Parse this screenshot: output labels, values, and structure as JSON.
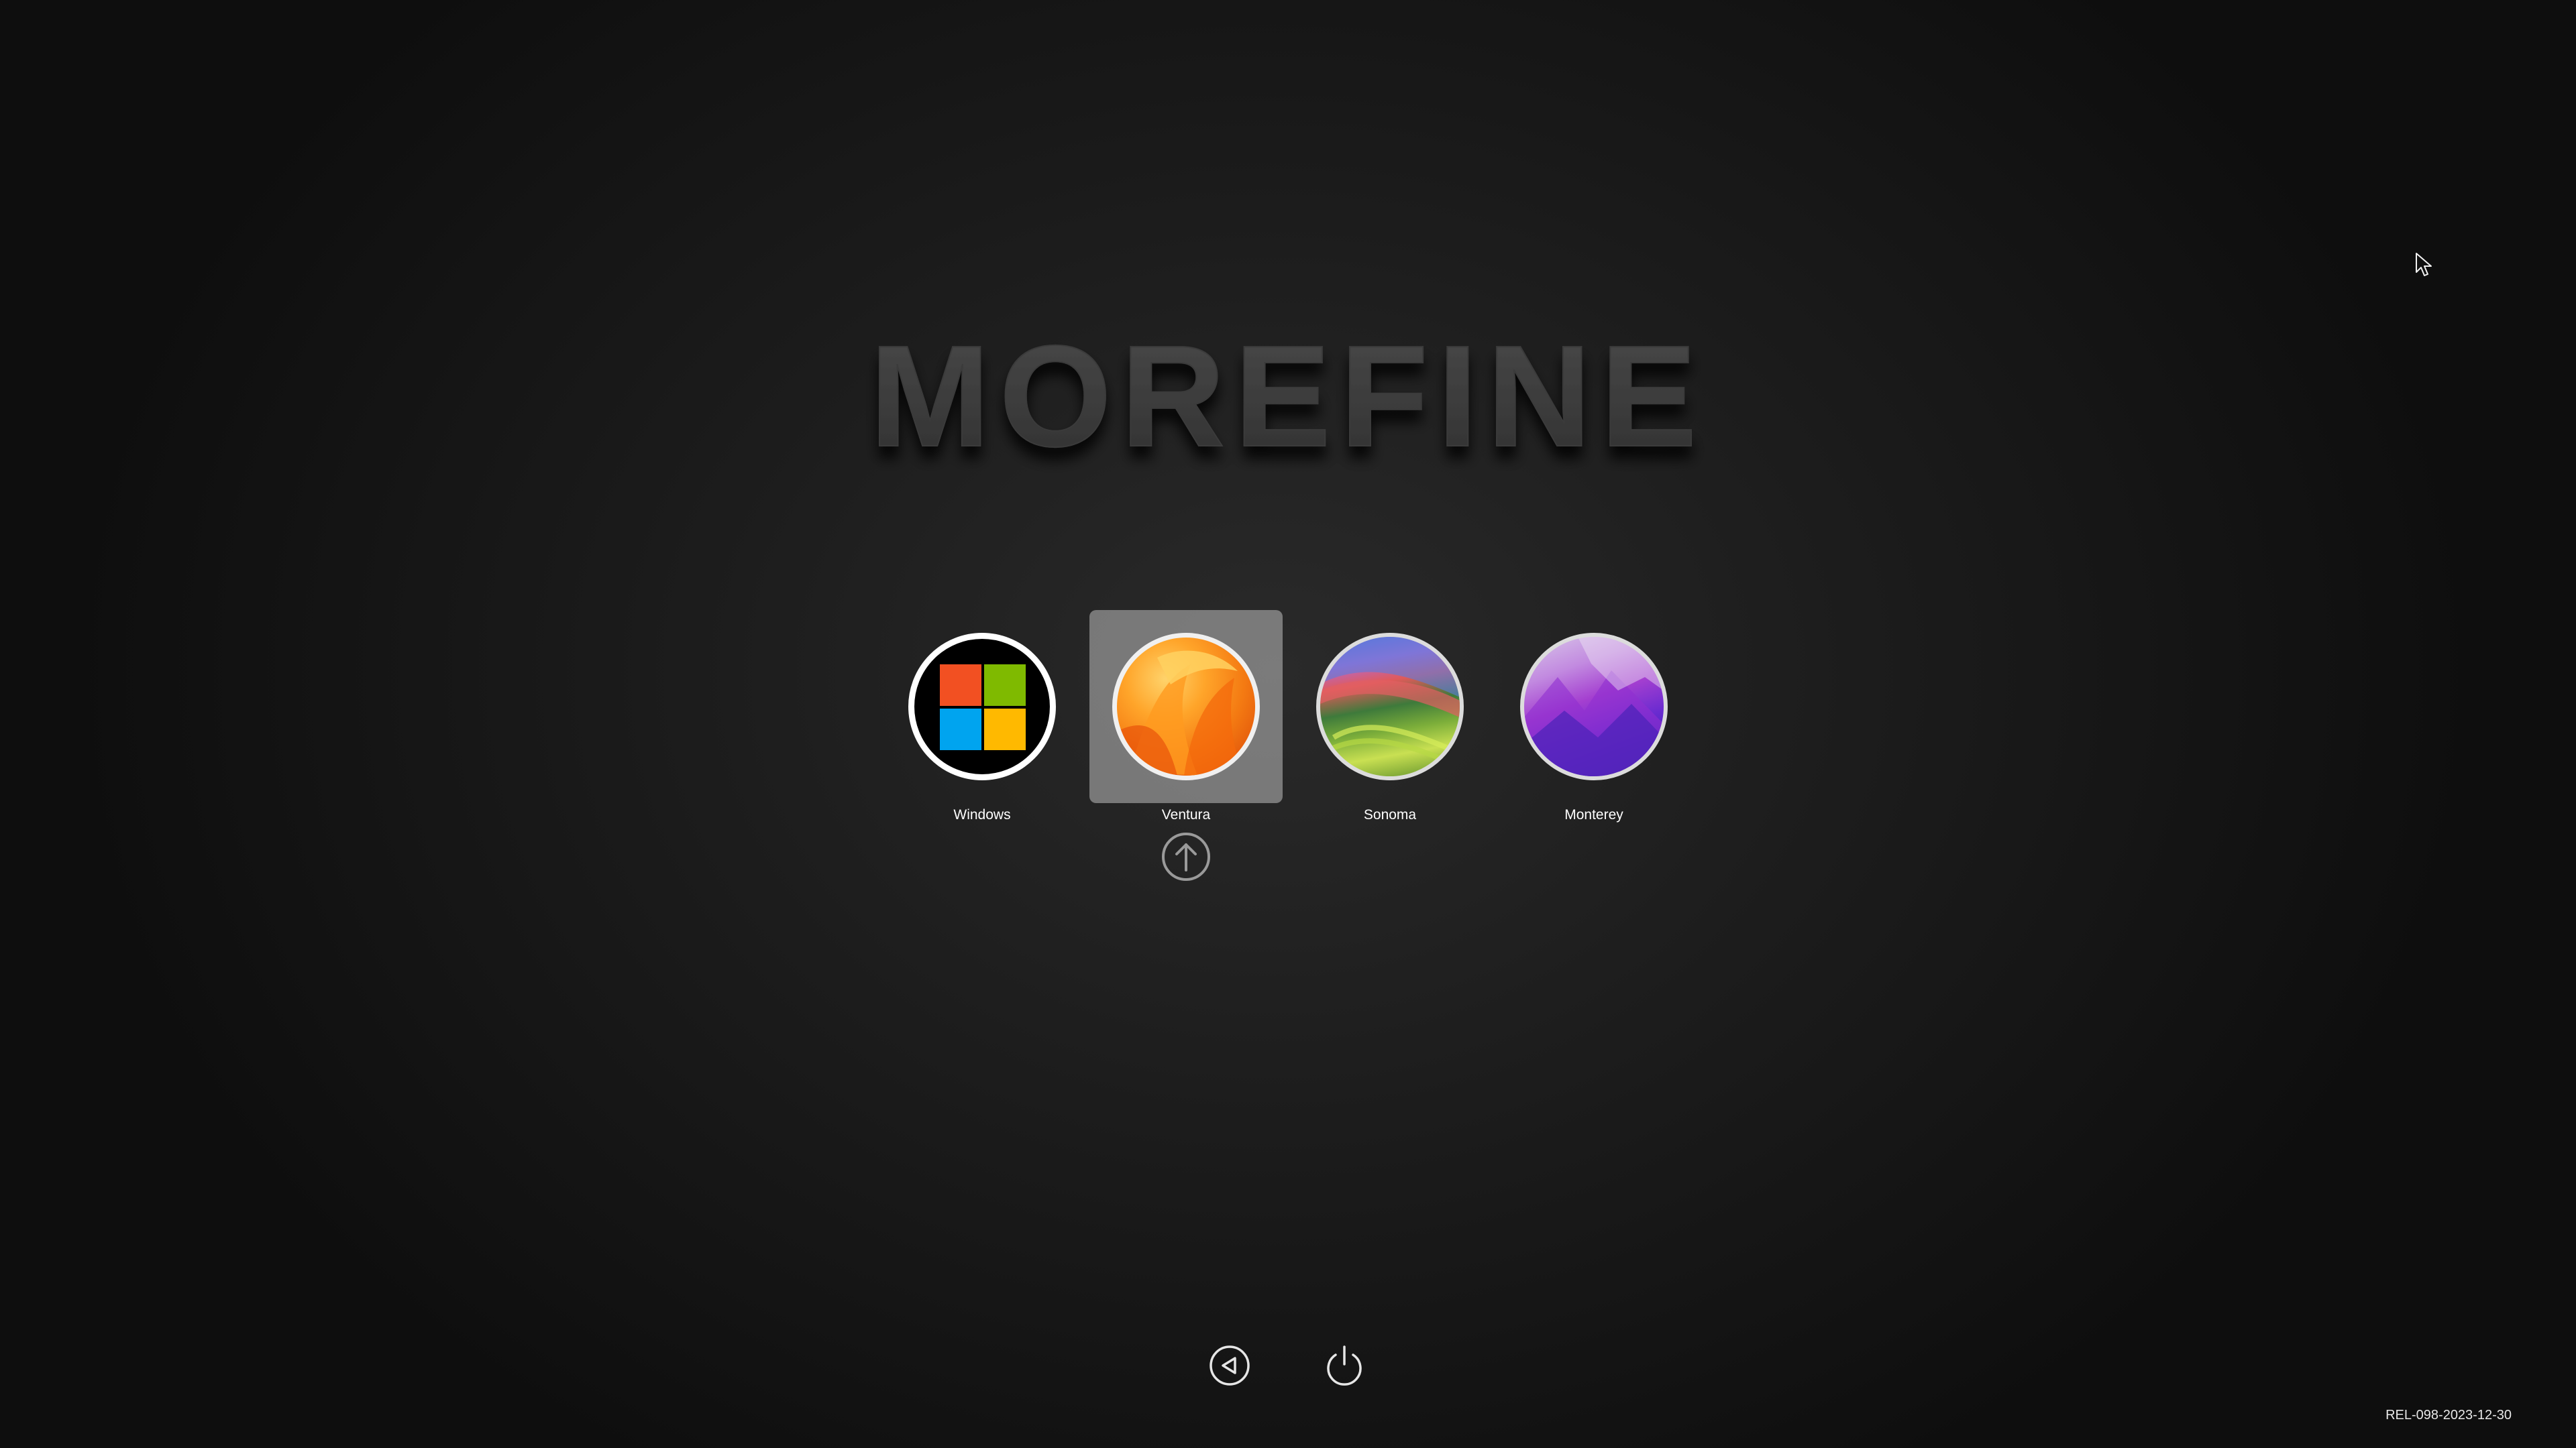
{
  "brand": {
    "logo_text": "MOREFINE"
  },
  "boot_entries": [
    {
      "label": "Windows",
      "icon": "windows-icon",
      "selected": false
    },
    {
      "label": "Ventura",
      "icon": "ventura-icon",
      "selected": true
    },
    {
      "label": "Sonoma",
      "icon": "sonoma-icon",
      "selected": false
    },
    {
      "label": "Monterey",
      "icon": "monterey-icon",
      "selected": false
    }
  ],
  "controls": {
    "selection_indicator": "up-arrow-icon",
    "back": "back-arrow-icon",
    "shutdown": "power-icon"
  },
  "version": "REL-098-2023-12-30",
  "colors": {
    "windows_red": "#f25022",
    "windows_green": "#7fba00",
    "windows_blue": "#00a4ef",
    "windows_yellow": "#ffb900",
    "selection_tile": "#8c8c8c"
  }
}
